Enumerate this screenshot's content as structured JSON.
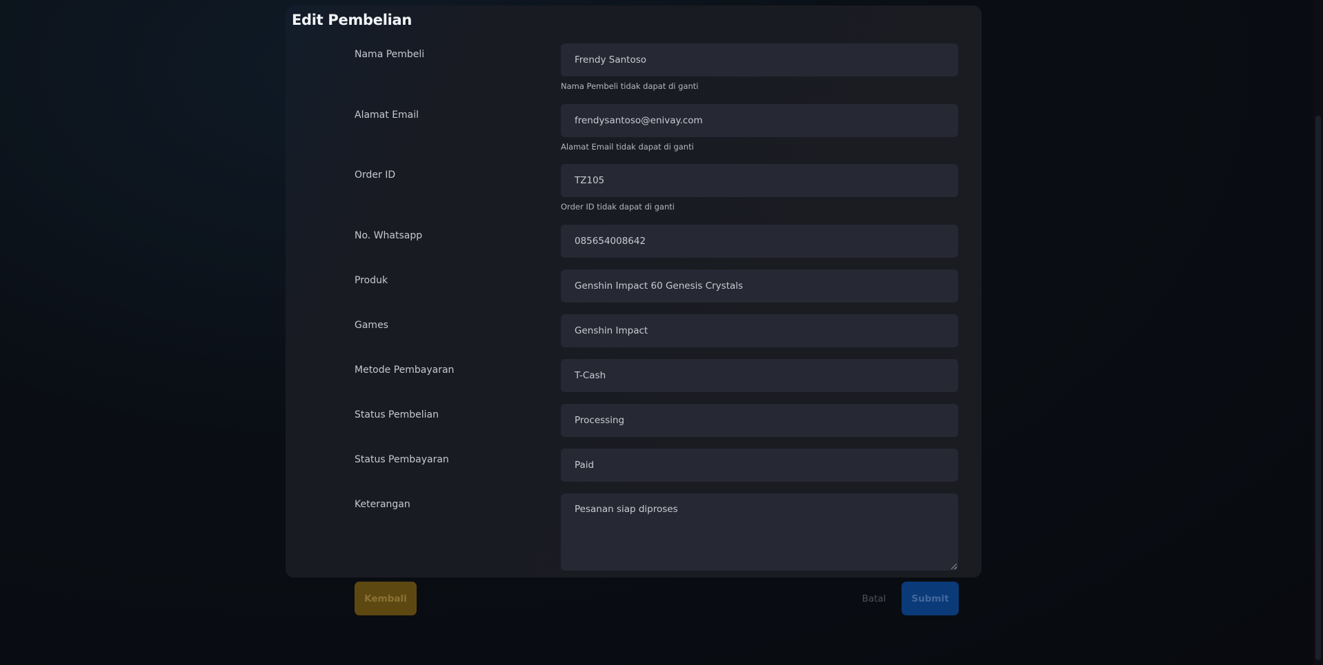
{
  "page_title": "Edit Pembelian",
  "fields": [
    {
      "label": "Nama Pembeli",
      "value": "Frendy Santoso",
      "help": "Nama Pembeli tidak dapat di ganti"
    },
    {
      "label": "Alamat Email",
      "value": "frendysantoso@enivay.com",
      "help": "Alamat Email tidak dapat di ganti"
    },
    {
      "label": "Order ID",
      "value": "TZ105",
      "help": "Order ID tidak dapat di ganti"
    },
    {
      "label": "No. Whatsapp",
      "value": "085654008642"
    },
    {
      "label": "Produk",
      "value": "Genshin Impact 60 Genesis Crystals"
    },
    {
      "label": "Games",
      "value": "Genshin Impact"
    },
    {
      "label": "Metode Pembayaran",
      "value": "T-Cash"
    },
    {
      "label": "Status Pembelian",
      "value": "Processing"
    },
    {
      "label": "Status Pembayaran",
      "value": "Paid"
    },
    {
      "label": "Keterangan",
      "value": "Pesanan siap diproses"
    }
  ],
  "actions": {
    "back_label": "Kembali",
    "cancel_label": "Batal",
    "submit_label": "Submit"
  },
  "colors": {
    "page_background": "#0b0d12",
    "card_background": "#1a1c22",
    "field_background": "#262833",
    "back_button": "#5e4812",
    "submit_button": "#0b3a78"
  }
}
